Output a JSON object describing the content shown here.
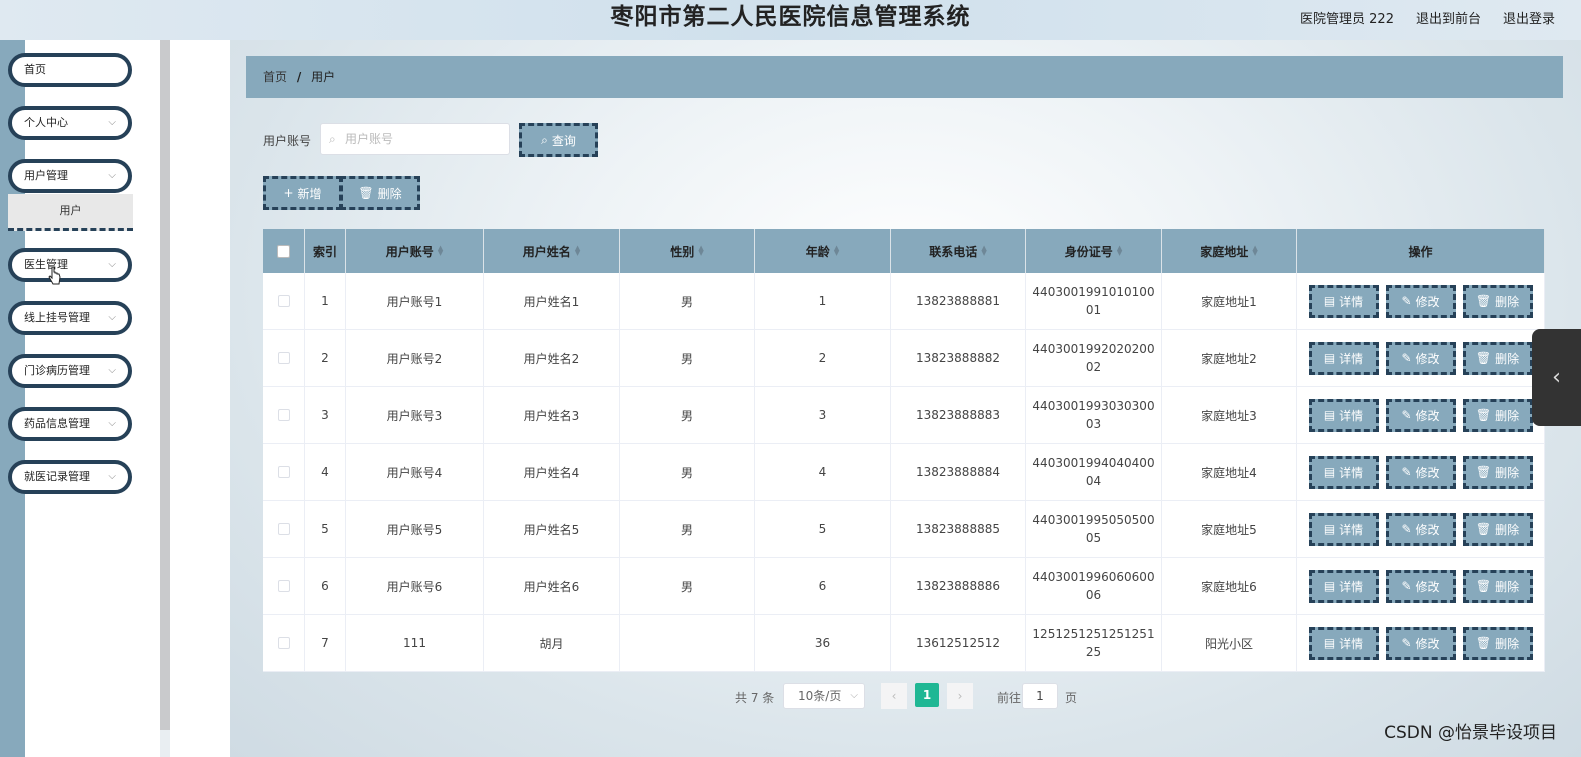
{
  "header": {
    "title": "枣阳市第二人民医院信息管理系统",
    "user": "医院管理员 222",
    "front_link": "退出到前台",
    "logout": "退出登录"
  },
  "sidebar": {
    "items": [
      {
        "label": "首页",
        "has_arrow": false
      },
      {
        "label": "个人中心",
        "has_arrow": true
      },
      {
        "label": "用户管理",
        "has_arrow": true
      },
      {
        "label": "医生管理",
        "has_arrow": true
      },
      {
        "label": "线上挂号管理",
        "has_arrow": true
      },
      {
        "label": "门诊病历管理",
        "has_arrow": true
      },
      {
        "label": "药品信息管理",
        "has_arrow": true
      },
      {
        "label": "就医记录管理",
        "has_arrow": true
      }
    ],
    "subitem": "用户"
  },
  "breadcrumb": {
    "home": "首页",
    "sep": "/",
    "current": "用户"
  },
  "search": {
    "label": "用户账号",
    "placeholder": "用户账号",
    "button": "查询"
  },
  "actions": {
    "add": "新增",
    "delete": "删除"
  },
  "table": {
    "columns": [
      "索引",
      "用户账号",
      "用户姓名",
      "性别",
      "年龄",
      "联系电话",
      "身份证号",
      "家庭地址",
      "操作"
    ],
    "rows": [
      {
        "index": "1",
        "account": "用户账号1",
        "name": "用户姓名1",
        "gender": "男",
        "age": "1",
        "phone": "13823888881",
        "idcard": "440300199101010001",
        "address": "家庭地址1"
      },
      {
        "index": "2",
        "account": "用户账号2",
        "name": "用户姓名2",
        "gender": "男",
        "age": "2",
        "phone": "13823888882",
        "idcard": "440300199202020002",
        "address": "家庭地址2"
      },
      {
        "index": "3",
        "account": "用户账号3",
        "name": "用户姓名3",
        "gender": "男",
        "age": "3",
        "phone": "13823888883",
        "idcard": "440300199303030003",
        "address": "家庭地址3"
      },
      {
        "index": "4",
        "account": "用户账号4",
        "name": "用户姓名4",
        "gender": "男",
        "age": "4",
        "phone": "13823888884",
        "idcard": "440300199404040004",
        "address": "家庭地址4"
      },
      {
        "index": "5",
        "account": "用户账号5",
        "name": "用户姓名5",
        "gender": "男",
        "age": "5",
        "phone": "13823888885",
        "idcard": "440300199505050005",
        "address": "家庭地址5"
      },
      {
        "index": "6",
        "account": "用户账号6",
        "name": "用户姓名6",
        "gender": "男",
        "age": "6",
        "phone": "13823888886",
        "idcard": "440300199606060006",
        "address": "家庭地址6"
      },
      {
        "index": "7",
        "account": "111",
        "name": "胡月",
        "gender": "",
        "age": "36",
        "phone": "13612512512",
        "idcard": "125125125125125125",
        "address": "阳光小区"
      }
    ],
    "op_labels": {
      "detail": "详情",
      "edit": "修改",
      "delete": "删除"
    }
  },
  "pagination": {
    "total": "共 7 条",
    "page_size": "10条/页",
    "current_page": "1",
    "goto_label": "前往",
    "goto_value": "1",
    "page_suffix": "页"
  },
  "watermark": "CSDN @怡景毕设项目",
  "colors": {
    "accent": "#87a9bc",
    "border_dark": "#264158",
    "current_page": "#1fb794"
  }
}
